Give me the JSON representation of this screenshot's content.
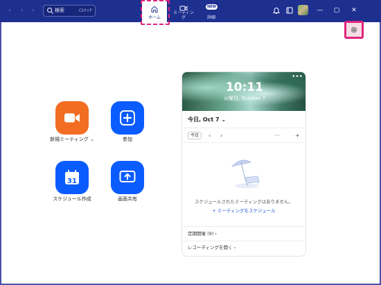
{
  "topbar": {
    "search": {
      "label": "検索",
      "shortcut": "Ctrl+F"
    },
    "tabs": [
      {
        "label": "ホーム"
      },
      {
        "label": "ミーティング"
      },
      {
        "label": "詳細",
        "badge": "NEW"
      }
    ]
  },
  "actions": [
    {
      "label": "新規ミーティング",
      "icon": "video-camera-icon",
      "color": "#f26d21"
    },
    {
      "label": "参加",
      "icon": "plus-icon",
      "color": "#0b5cff"
    },
    {
      "label": "スケジュール作成",
      "icon": "calendar-icon",
      "calendar_day": "31",
      "color": "#0b5cff"
    },
    {
      "label": "画面共有",
      "icon": "share-screen-icon",
      "color": "#0b5cff"
    }
  ],
  "card": {
    "time": "10:11",
    "date": "火曜日, October 7",
    "today_header": "今日, Oct 7",
    "today_button": "今日",
    "empty_text": "スケジュールされたミーティングはありません。",
    "schedule_link": "ミーティングをスケジュール",
    "recurring": "定期開催 (9)",
    "recordings": "レコーディングを開く"
  },
  "colors": {
    "topbar": "#1d2f8f",
    "accent": "#0b5cff",
    "orange": "#f26d21",
    "highlight": "#e0247c"
  }
}
